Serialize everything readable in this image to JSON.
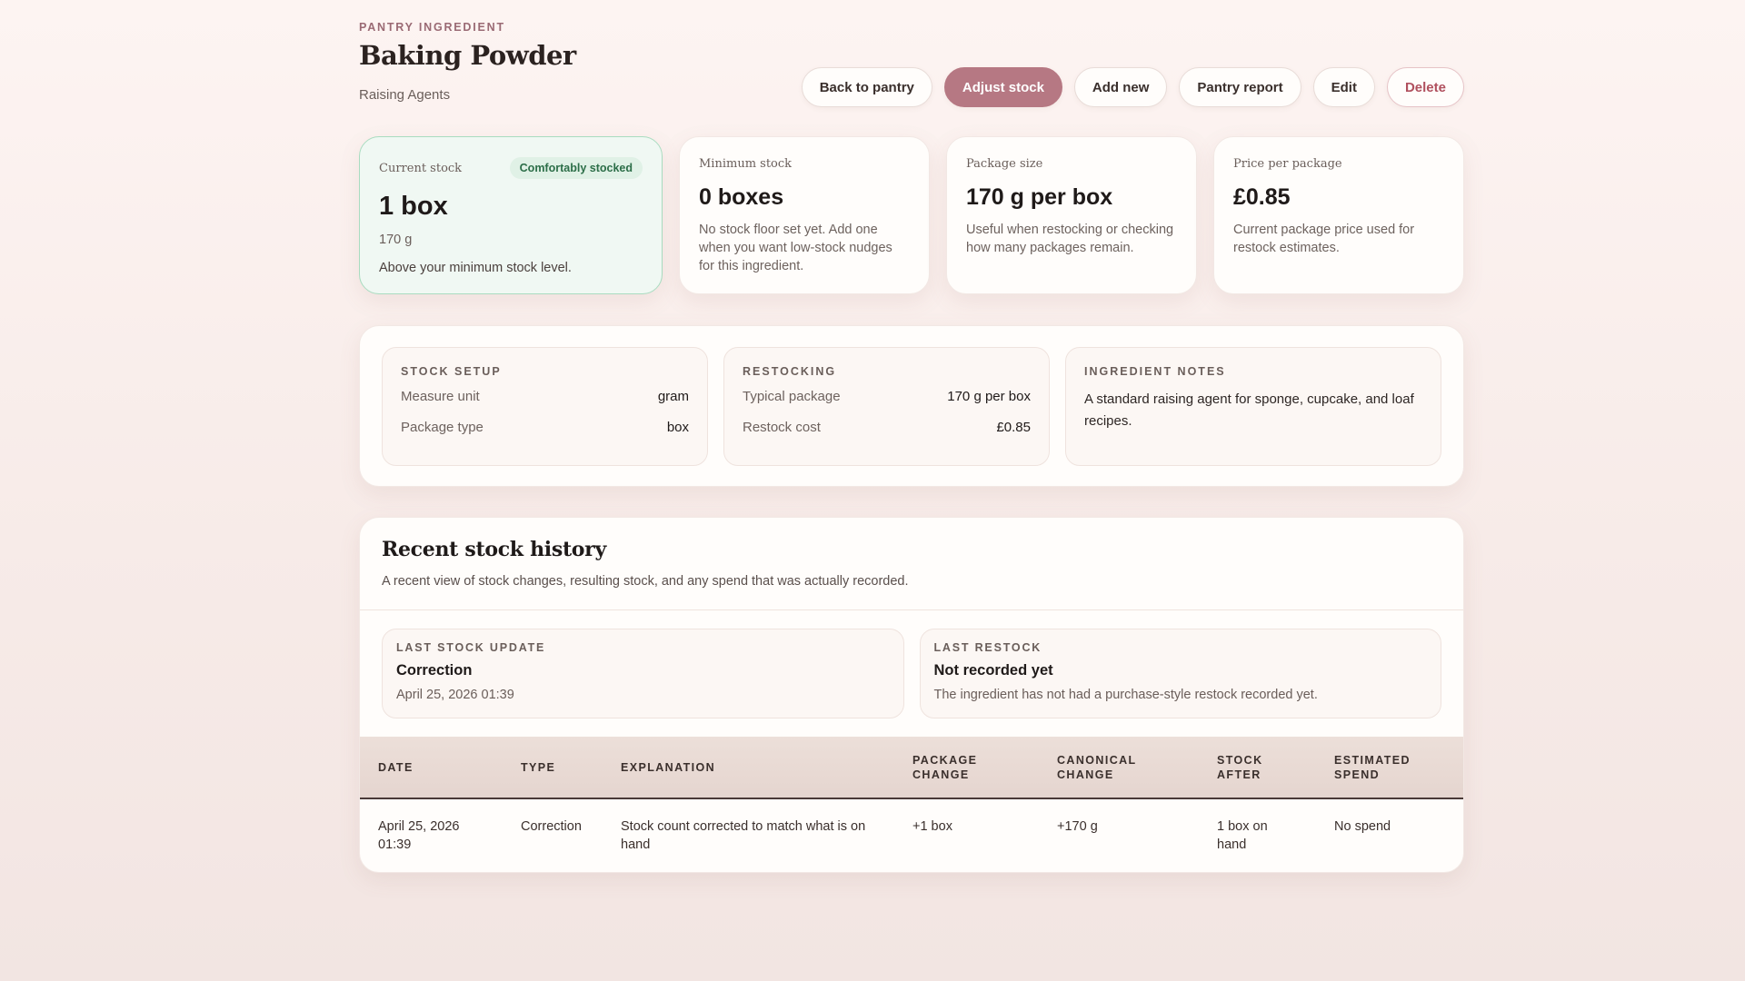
{
  "header": {
    "eyebrow": "PANTRY INGREDIENT",
    "title": "Baking Powder",
    "category": "Raising Agents"
  },
  "actions": {
    "back": "Back to pantry",
    "adjust": "Adjust stock",
    "add_new": "Add new",
    "report": "Pantry report",
    "edit": "Edit",
    "delete": "Delete"
  },
  "stats": {
    "current": {
      "label": "Current stock",
      "badge": "Comfortably stocked",
      "value": "1 box",
      "sub": "170 g",
      "note": "Above your minimum stock level."
    },
    "minimum": {
      "label": "Minimum stock",
      "value": "0 boxes",
      "desc": "No stock floor set yet. Add one when you want low-stock nudges for this ingredient."
    },
    "package": {
      "label": "Package size",
      "value": "170 g per box",
      "desc": "Useful when restocking or checking how many packages remain."
    },
    "price": {
      "label": "Price per package",
      "value": "£0.85",
      "desc": "Current package price used for restock estimates."
    }
  },
  "setup": {
    "stock_setup": {
      "title": "STOCK SETUP",
      "measure_unit_label": "Measure unit",
      "measure_unit": "gram",
      "package_type_label": "Package type",
      "package_type": "box"
    },
    "restocking": {
      "title": "RESTOCKING",
      "typical_package_label": "Typical package",
      "typical_package": "170 g per box",
      "restock_cost_label": "Restock cost",
      "restock_cost": "£0.85"
    },
    "notes": {
      "title": "INGREDIENT NOTES",
      "text": "A standard raising agent for sponge, cupcake, and loaf recipes."
    }
  },
  "history": {
    "title": "Recent stock history",
    "desc": "A recent view of stock changes, resulting stock, and any spend that was actually recorded.",
    "last_update": {
      "label": "LAST STOCK UPDATE",
      "value": "Correction",
      "meta": "April 25, 2026 01:39"
    },
    "last_restock": {
      "label": "LAST RESTOCK",
      "value": "Not recorded yet",
      "meta": "The ingredient has not had a purchase-style restock recorded yet."
    },
    "columns": [
      "DATE",
      "TYPE",
      "EXPLANATION",
      "PACKAGE CHANGE",
      "CANONICAL CHANGE",
      "STOCK AFTER",
      "ESTIMATED SPEND"
    ],
    "rows": [
      {
        "date": "April 25, 2026 01:39",
        "type": "Correction",
        "explanation": "Stock count corrected to match what is on hand",
        "package_change": "+1 box",
        "canonical_change": "+170 g",
        "stock_after": "1 box on hand",
        "spend": "No spend"
      }
    ]
  },
  "colors": {
    "accent": "#b67883",
    "success": "#2c6e48",
    "danger": "#b0505e"
  }
}
